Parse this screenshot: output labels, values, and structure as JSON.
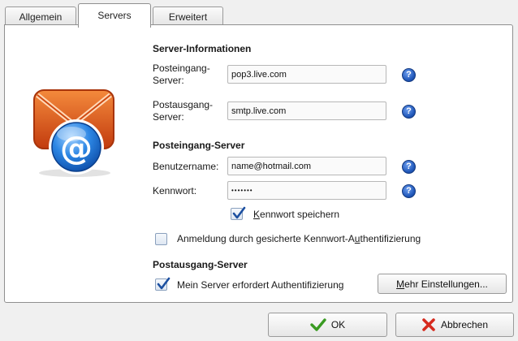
{
  "tabs": [
    {
      "label": "Allgemein"
    },
    {
      "label": "Servers"
    },
    {
      "label": "Erweitert"
    }
  ],
  "server_info": {
    "heading": "Server-Informationen",
    "incoming_label_1": "Posteingang-",
    "incoming_label_2": "Server:",
    "incoming_value": "pop3.live.com",
    "outgoing_label_1": "Postausgang-",
    "outgoing_label_2": "Server:",
    "outgoing_value": "smtp.live.com"
  },
  "incoming_server": {
    "heading": "Posteingang-Server",
    "username_label": "Benutzername:",
    "username_value": "name@hotmail.com",
    "password_label": "Kennwort:",
    "password_value": "•••••••",
    "save_password_label_pre": "",
    "save_password_label_u": "K",
    "save_password_label_post": "ennwort speichern",
    "save_password_checked": true,
    "spa_label_pre": "Anmeldung durch gesicherte Kennwort-A",
    "spa_label_u": "u",
    "spa_label_post": "thentifizierung",
    "spa_checked": false
  },
  "outgoing_server": {
    "heading": "Postausgang-Server",
    "auth_label": "Mein Server erfordert Authentifizierung",
    "auth_checked": true,
    "more_settings_u": "M",
    "more_settings_post": "ehr Einstellungen..."
  },
  "help_symbol": "?",
  "icons": {
    "mail": "email-envelope-icon",
    "help": "help-icon",
    "ok": "checkmark-icon",
    "cancel": "cancel-x-icon"
  },
  "colors": {
    "envelope": "#e2561a",
    "globe": "#1e74d6",
    "ok_check": "#3a9b22",
    "cancel_x": "#d62a1e"
  },
  "footer": {
    "ok_label": "OK",
    "cancel_label": "Abbrechen"
  }
}
